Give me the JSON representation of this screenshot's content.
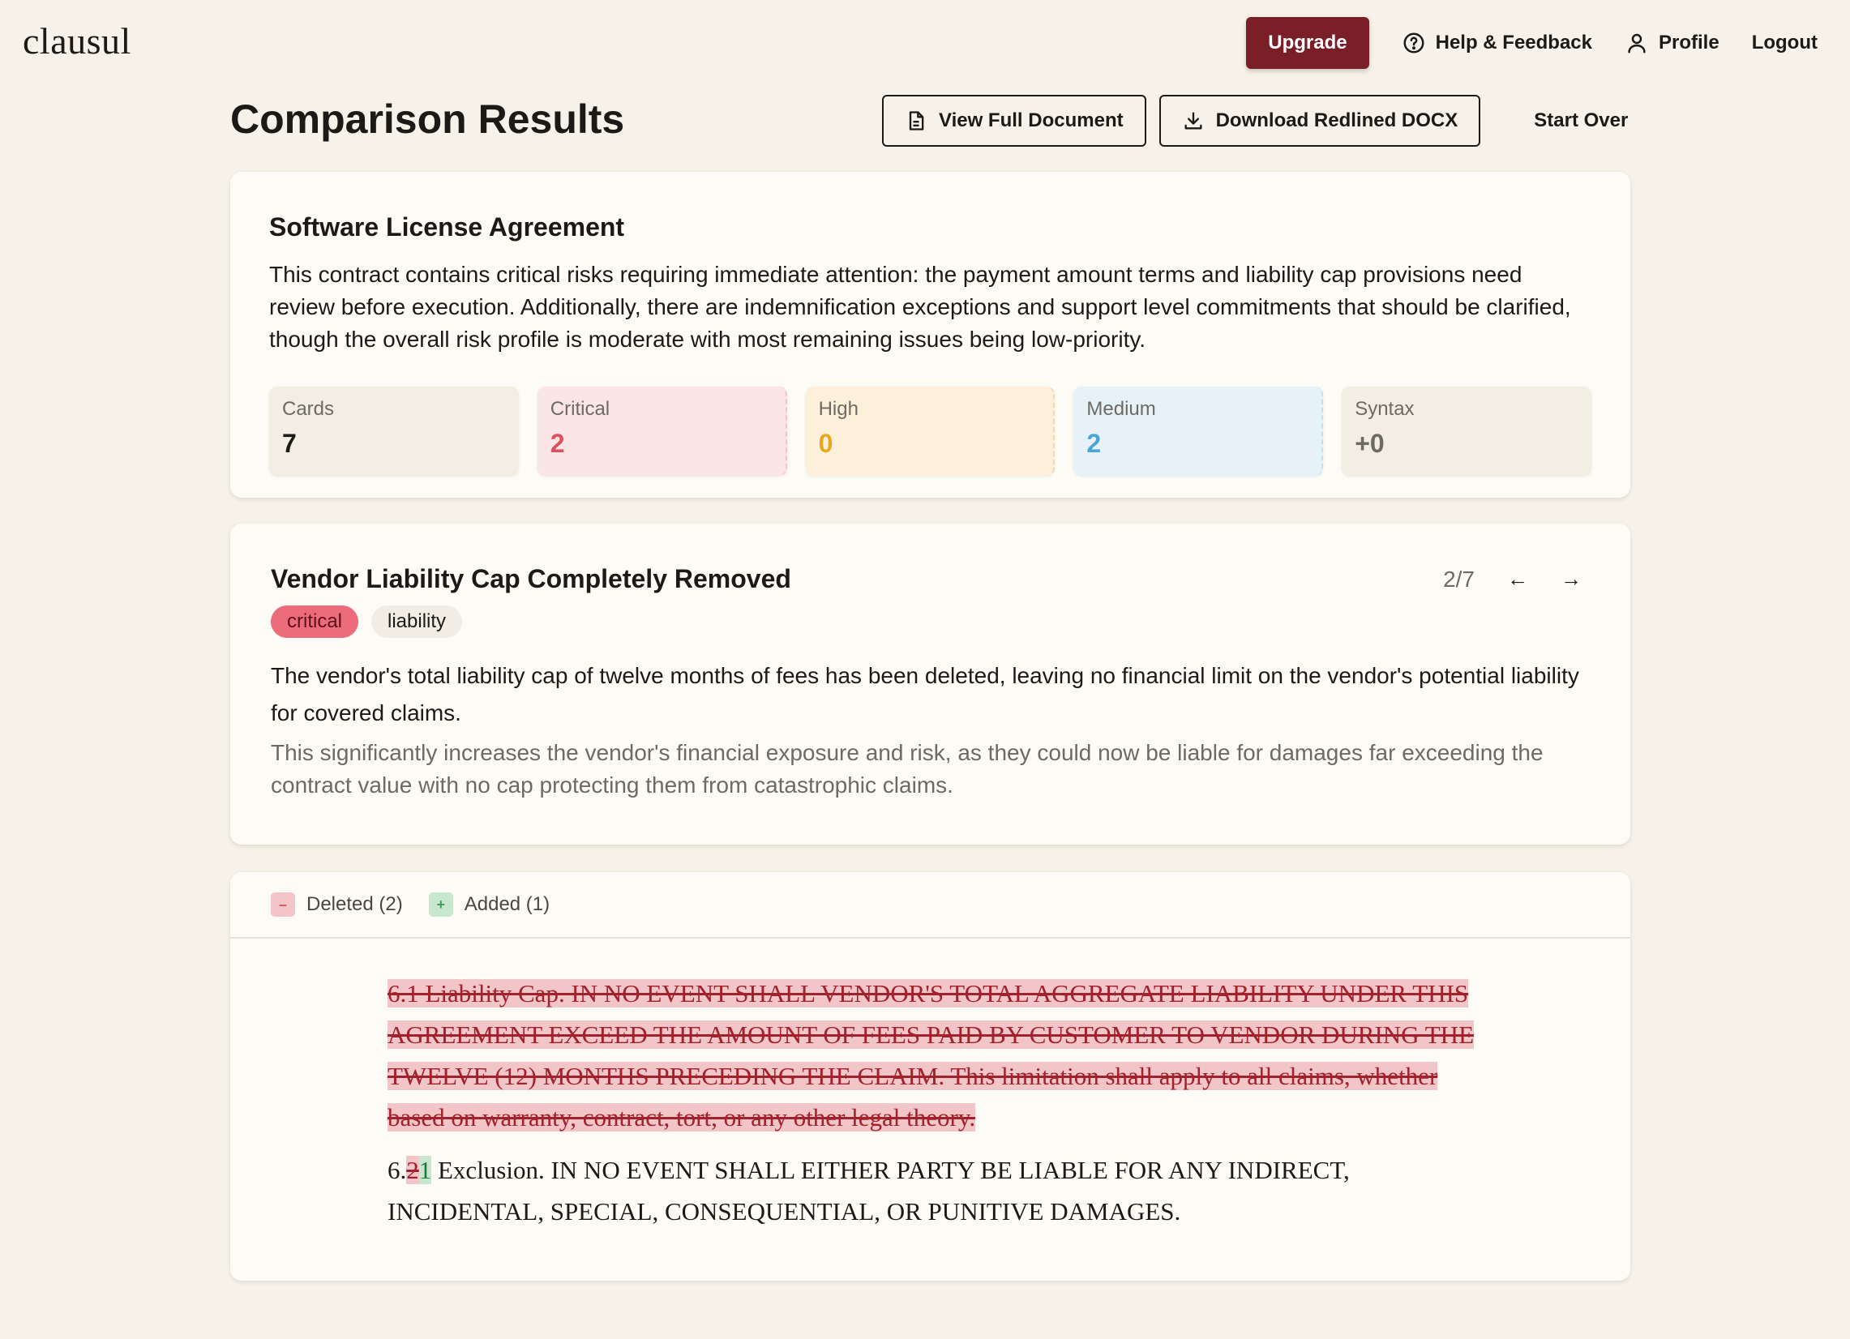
{
  "app": {
    "logo": "clausul"
  },
  "nav": {
    "upgrade": "Upgrade",
    "help": "Help & Feedback",
    "profile": "Profile",
    "logout": "Logout"
  },
  "header": {
    "title": "Comparison Results",
    "view_full": "View Full Document",
    "download": "Download Redlined DOCX",
    "start_over": "Start Over"
  },
  "summary": {
    "doc_title": "Software License Agreement",
    "text": "This contract contains critical risks requiring immediate attention: the payment amount terms and liability cap provisions need review before execution. Additionally, there are indemnification exceptions and support level commitments that should be clarified, though the overall risk profile is moderate with most remaining issues being low-priority.",
    "stats": {
      "cards": {
        "label": "Cards",
        "value": "7"
      },
      "critical": {
        "label": "Critical",
        "value": "2"
      },
      "high": {
        "label": "High",
        "value": "0"
      },
      "medium": {
        "label": "Medium",
        "value": "2"
      },
      "syntax": {
        "label": "Syntax",
        "value": "+0"
      }
    }
  },
  "issue": {
    "title": "Vendor Liability Cap Completely Removed",
    "position": "2/7",
    "severity": "critical",
    "category": "liability",
    "description": "The vendor's total liability cap of twelve months of fees has been deleted, leaving no financial limit on the vendor's potential liability for covered claims.",
    "impact": "This significantly increases the vendor's financial exposure and risk, as they could now be liable for damages far exceeding the contract value with no cap protecting them from catastrophic claims."
  },
  "diff": {
    "legend": {
      "deleted": "Deleted (2)",
      "added": "Added (1)"
    },
    "deleted_paragraph": "6.1 Liability Cap. IN NO EVENT SHALL VENDOR'S TOTAL AGGREGATE LIABILITY UNDER THIS AGREEMENT EXCEED THE AMOUNT OF FEES PAID BY CUSTOMER TO VENDOR DURING THE TWELVE (12) MONTHS PRECEDING THE CLAIM. This limitation shall apply to all claims, whether based on warranty, contract, tort, or any other legal theory.",
    "kept_prefix": "6.",
    "kept_deleted": "2",
    "kept_added": "1",
    "kept_rest": " Exclusion. IN NO EVENT SHALL EITHER PARTY BE LIABLE FOR ANY INDIRECT, INCIDENTAL, SPECIAL, CONSEQUENTIAL, OR PUNITIVE DAMAGES."
  },
  "colors": {
    "brand": "#7a1f28",
    "background": "#f6f2e9",
    "critical": "#d9525f",
    "high": "#e6a91b",
    "medium": "#4aa6d6",
    "deleted_bg": "#f2c6c8",
    "added_bg": "#c9e7cf"
  },
  "icons": [
    "help-circle-icon",
    "user-icon",
    "document-icon",
    "download-icon",
    "arrow-left-icon",
    "arrow-right-icon",
    "minus-icon",
    "plus-icon"
  ]
}
